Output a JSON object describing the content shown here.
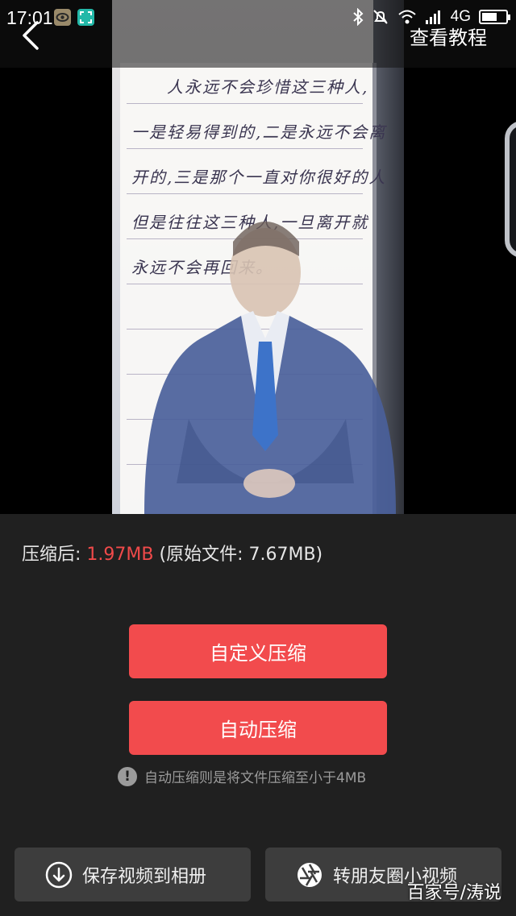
{
  "status_bar": {
    "time": "17:01",
    "network": "4G",
    "battery_level": 0.55,
    "icons": [
      "eye-app-icon",
      "scan-app-icon",
      "bluetooth-icon",
      "mute-bell-icon",
      "wifi-icon",
      "signal-icon",
      "battery-icon"
    ]
  },
  "topbar": {
    "back_icon": "chevron-left-icon",
    "tutorial_label": "查看教程"
  },
  "video": {
    "handwriting_lines": [
      "人永远不会珍惜这三种人,",
      "一是轻易得到的,二是永远不会离",
      "开的,三是那个一直对你很好的人",
      "但是往往这三种人,一旦离开就",
      "永远不会再回来。"
    ]
  },
  "info": {
    "after_label": "压缩后:",
    "after_size": "1.97MB",
    "original_text": "(原始文件: 7.67MB)"
  },
  "actions": {
    "custom_compress": "自定义压缩",
    "auto_compress": "自动压缩",
    "note": "自动压缩则是将文件压缩至小于4MB"
  },
  "bottom": {
    "save_label": "保存视频到相册",
    "share_label": "转朋友圈小视频"
  },
  "watermark": "百家号/涛说",
  "colors": {
    "accent_red": "#f24b4d",
    "size_red": "#f04a4a",
    "background": "#202020",
    "dark_button": "#3d3d3d"
  }
}
